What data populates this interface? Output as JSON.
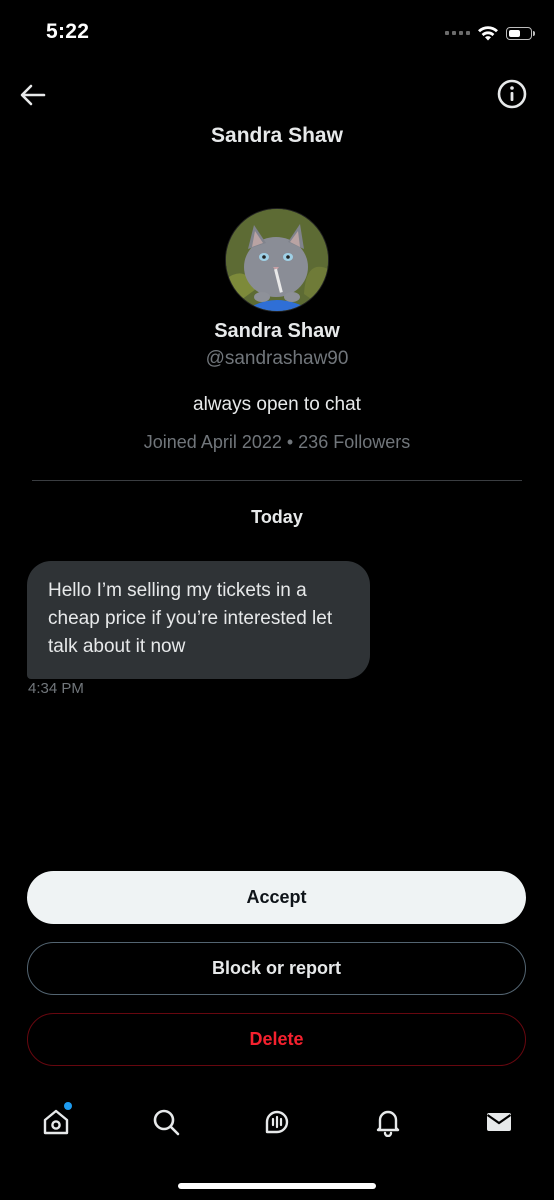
{
  "status_bar": {
    "time": "5:22",
    "battery_level": 0.6
  },
  "header": {
    "title": "Sandra Shaw",
    "back_icon": "arrow-left-icon",
    "info_icon": "info-icon"
  },
  "profile": {
    "name": "Sandra Shaw",
    "handle": "@sandrashaw90",
    "bio": "always open to chat",
    "meta": "Joined April 2022 • 236 Followers"
  },
  "conversation": {
    "date_label": "Today",
    "messages": [
      {
        "text": "Hello I’m selling my tickets in a cheap price if you’re interested let talk about it now",
        "time": "4:34 PM"
      }
    ]
  },
  "actions": {
    "accept": "Accept",
    "block_or_report": "Block or report",
    "delete": "Delete"
  },
  "tabbar": {
    "items": [
      "home-icon",
      "search-icon",
      "spaces-icon",
      "notifications-icon",
      "messages-icon"
    ]
  },
  "colors": {
    "background": "#000000",
    "bubble": "#2f3336",
    "accept_bg": "#eff3f4",
    "delete_red": "#f4212e",
    "accent_blue": "#1d9bf0",
    "muted_text": "#71767b"
  }
}
